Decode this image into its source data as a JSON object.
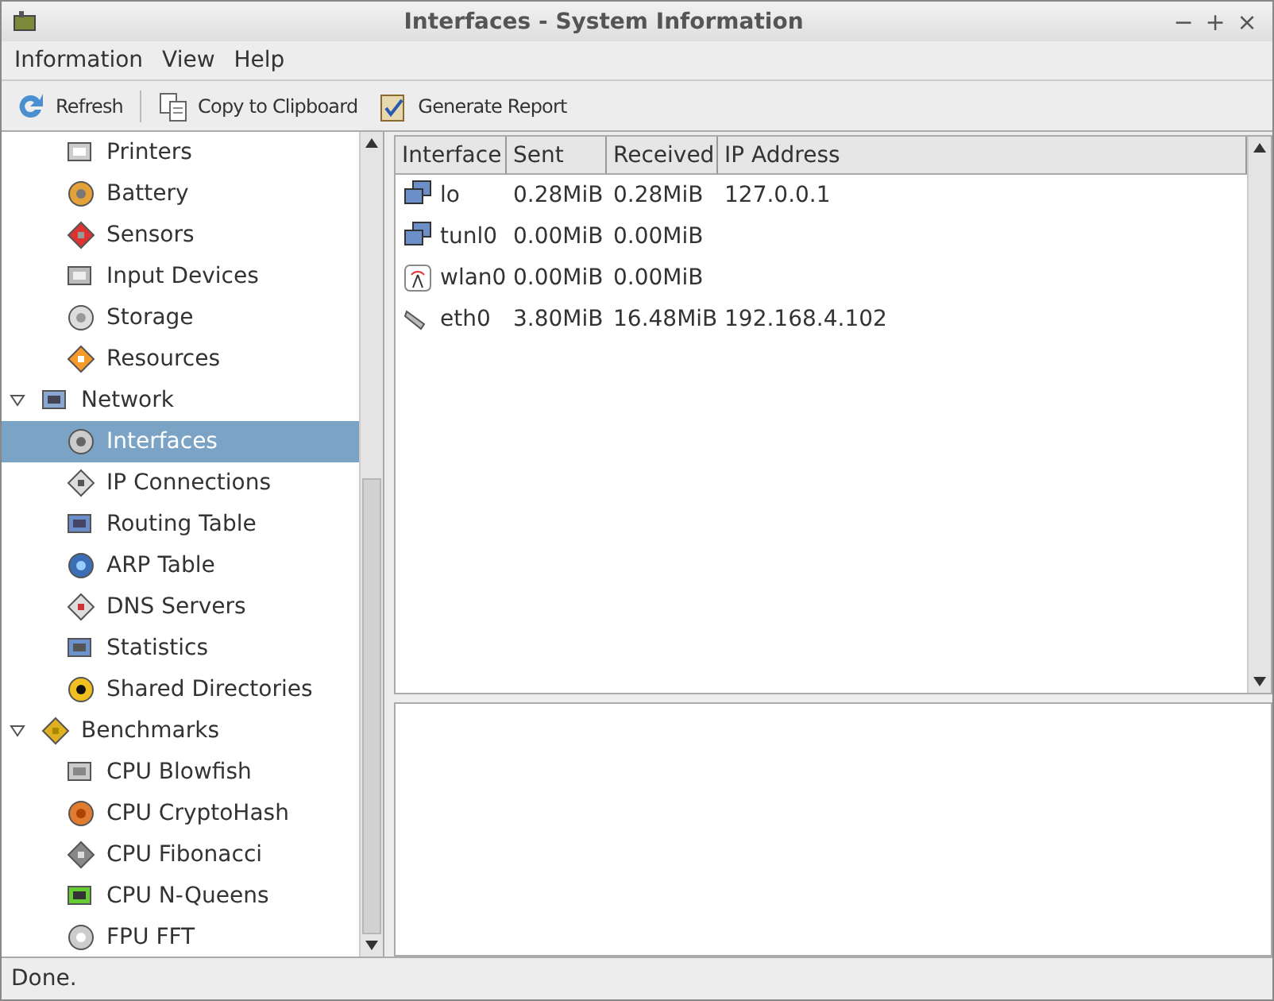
{
  "window": {
    "title": "Interfaces - System Information",
    "controls": [
      "−",
      "+",
      "×"
    ]
  },
  "menu": [
    "Information",
    "View",
    "Help"
  ],
  "toolbar_groups": [
    [
      "Refresh"
    ],
    [
      "Copy to Clipboard",
      "Generate Report"
    ]
  ],
  "sidebar": {
    "continued_items": [
      {
        "label": "Printers",
        "selected": false
      },
      {
        "label": "Battery",
        "selected": false
      },
      {
        "label": "Sensors",
        "selected": false
      },
      {
        "label": "Input Devices",
        "selected": false
      },
      {
        "label": "Storage",
        "selected": false
      },
      {
        "label": "Resources",
        "selected": false
      }
    ],
    "items": [
      {
        "label": "Network",
        "selected": false,
        "expanded": true,
        "children": [
          {
            "label": "Interfaces",
            "selected": true
          },
          {
            "label": "IP Connections",
            "selected": false
          },
          {
            "label": "Routing Table",
            "selected": false
          },
          {
            "label": "ARP Table",
            "selected": false
          },
          {
            "label": "DNS Servers",
            "selected": false
          },
          {
            "label": "Statistics",
            "selected": false
          },
          {
            "label": "Shared Directories",
            "selected": false
          }
        ]
      },
      {
        "label": "Benchmarks",
        "selected": false,
        "expanded": true,
        "children": [
          {
            "label": "CPU Blowfish",
            "selected": false
          },
          {
            "label": "CPU CryptoHash",
            "selected": false
          },
          {
            "label": "CPU Fibonacci",
            "selected": false
          },
          {
            "label": "CPU N-Queens",
            "selected": false
          },
          {
            "label": "FPU FFT",
            "selected": false
          }
        ]
      }
    ]
  },
  "table": {
    "columns": [
      "Interface",
      "Sent",
      "Received",
      "IP Address"
    ],
    "rows": [
      {
        "interface": "lo",
        "sent": "0.28MiB",
        "received": "0.28MiB",
        "ip": "127.0.0.1"
      },
      {
        "interface": "tunl0",
        "sent": "0.00MiB",
        "received": "0.00MiB"
      },
      {
        "interface": "wlan0",
        "sent": "0.00MiB",
        "received": "0.00MiB"
      },
      {
        "interface": "eth0",
        "sent": "3.80MiB",
        "received": "16.48MiB",
        "ip": "192.168.4.102"
      }
    ]
  },
  "status_bar": "Done."
}
